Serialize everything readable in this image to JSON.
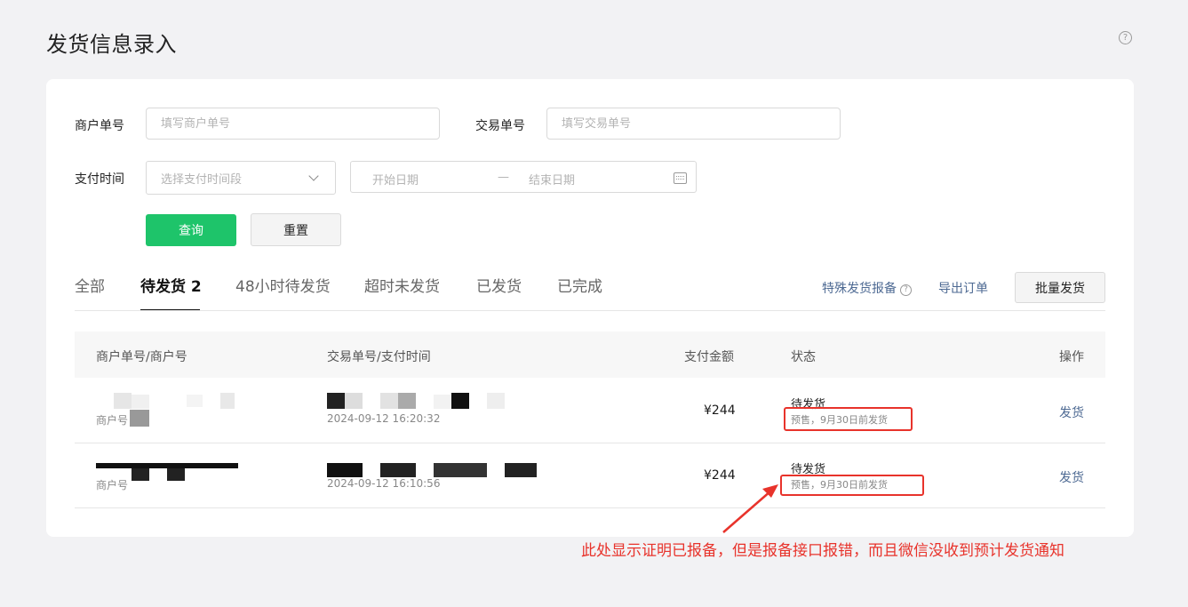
{
  "page": {
    "title": "发货信息录入"
  },
  "filters": {
    "merchant_order_label": "商户单号",
    "merchant_order_placeholder": "填写商户单号",
    "trade_no_label": "交易单号",
    "trade_no_placeholder": "填写交易单号",
    "pay_time_label": "支付时间",
    "pay_time_select": "选择支付时间段",
    "start_date": "开始日期",
    "date_separator": "—",
    "end_date": "结束日期",
    "query_button": "查询",
    "reset_button": "重置"
  },
  "tabs": [
    {
      "label": "全部"
    },
    {
      "label": "待发货 2"
    },
    {
      "label": "48小时待发货"
    },
    {
      "label": "超时未发货"
    },
    {
      "label": "已发货"
    },
    {
      "label": "已完成"
    }
  ],
  "actions": {
    "special_report": "特殊发货报备",
    "export": "导出订单",
    "batch_ship": "批量发货"
  },
  "table": {
    "headers": [
      "商户单号/商户号",
      "交易单号/支付时间",
      "支付金额",
      "状态",
      "操作"
    ],
    "rows": [
      {
        "merchant_label": "商户号",
        "pay_time": "2024-09-12 16:20:32",
        "amount": "¥244",
        "status": "待发货",
        "status_note": "预售，9月30日前发货",
        "action": "发货"
      },
      {
        "merchant_label": "商户号",
        "pay_time": "2024-09-12 16:10:56",
        "amount": "¥244",
        "status": "待发货",
        "status_note": "预售，9月30日前发货",
        "action": "发货"
      }
    ]
  },
  "annotation": {
    "text": "此处显示证明已报备，但是报备接口报错，而且微信没收到预计发货通知",
    "color": "#e8332b"
  },
  "colors": {
    "primary": "#1ec46a",
    "link": "#4e6a93",
    "annotation_red": "#e8332b"
  }
}
